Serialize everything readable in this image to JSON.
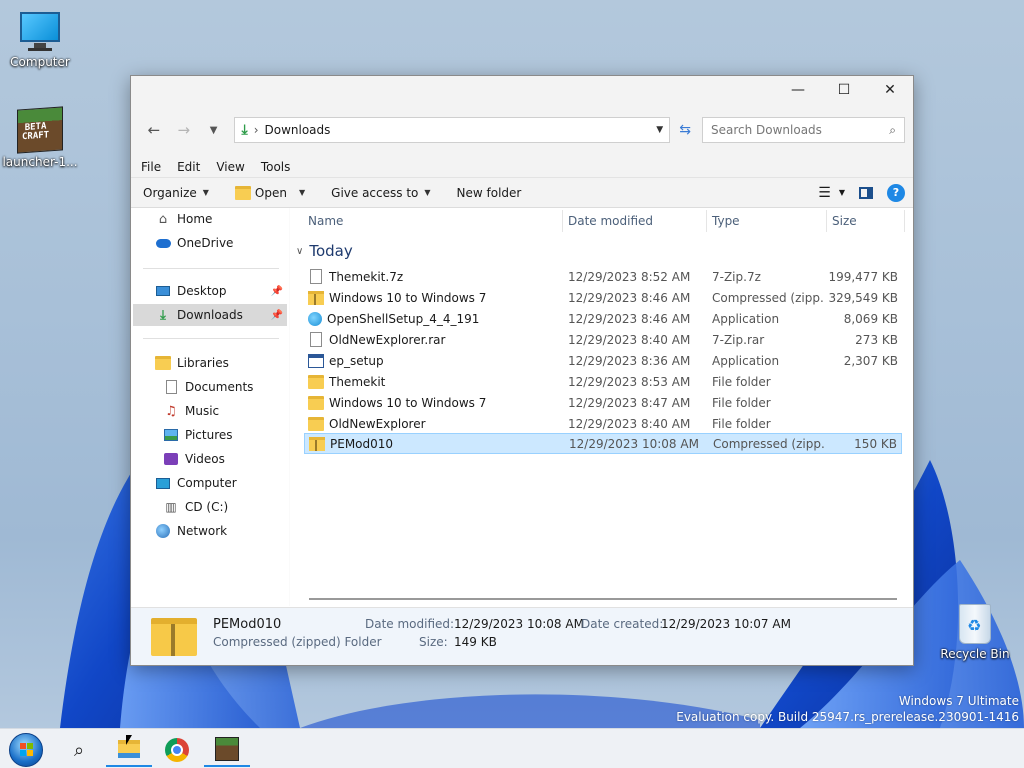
{
  "desktop": {
    "icons": [
      {
        "label": "Computer"
      },
      {
        "label": "launcher-1..."
      },
      {
        "label": "Recycle Bin"
      }
    ],
    "watermark": {
      "line1": "Windows 7 Ultimate",
      "line2": "Evaluation copy. Build 25947.rs_prerelease.230901-1416"
    }
  },
  "window": {
    "controls": {
      "minimize": "—",
      "maximize": "☐",
      "close": "✕"
    },
    "address": {
      "crumb_separator": "›",
      "location": "Downloads"
    },
    "search": {
      "placeholder": "Search Downloads"
    },
    "menu": [
      "File",
      "Edit",
      "View",
      "Tools"
    ],
    "commands": {
      "organize": "Organize",
      "open": "Open",
      "give_access": "Give access to",
      "new_folder": "New folder"
    },
    "nav": [
      {
        "label": "Home",
        "icon": "home-icon"
      },
      {
        "label": "OneDrive",
        "icon": "cloud-icon"
      },
      {
        "label": "Desktop",
        "icon": "desktop-icon",
        "pinned": true
      },
      {
        "label": "Downloads",
        "icon": "download-icon",
        "pinned": true,
        "selected": true
      },
      {
        "label": "Libraries",
        "icon": "libraries-icon"
      },
      {
        "label": "Documents",
        "icon": "documents-icon"
      },
      {
        "label": "Music",
        "icon": "music-icon"
      },
      {
        "label": "Pictures",
        "icon": "pictures-icon"
      },
      {
        "label": "Videos",
        "icon": "videos-icon"
      },
      {
        "label": "Computer",
        "icon": "computer-icon"
      },
      {
        "label": "CD (C:)",
        "icon": "drive-icon"
      },
      {
        "label": "Network",
        "icon": "network-icon"
      }
    ],
    "columns": {
      "name": "Name",
      "date": "Date modified",
      "type": "Type",
      "size": "Size"
    },
    "group": "Today",
    "files": [
      {
        "name": "Themekit.7z",
        "date": "12/29/2023 8:52 AM",
        "type": "7-Zip.7z",
        "size": "199,477 KB",
        "icon": "document-icon"
      },
      {
        "name": "Windows 10 to Windows 7",
        "date": "12/29/2023 8:46 AM",
        "type": "Compressed (zipp...",
        "size": "329,549 KB",
        "icon": "zip-folder-icon"
      },
      {
        "name": "OpenShellSetup_4_4_191",
        "date": "12/29/2023 8:46 AM",
        "type": "Application",
        "size": "8,069 KB",
        "icon": "shell-icon"
      },
      {
        "name": "OldNewExplorer.rar",
        "date": "12/29/2023 8:40 AM",
        "type": "7-Zip.rar",
        "size": "273 KB",
        "icon": "document-icon"
      },
      {
        "name": "ep_setup",
        "date": "12/29/2023 8:36 AM",
        "type": "Application",
        "size": "2,307 KB",
        "icon": "app-icon"
      },
      {
        "name": "Themekit",
        "date": "12/29/2023 8:53 AM",
        "type": "File folder",
        "size": "",
        "icon": "folder-icon"
      },
      {
        "name": "Windows 10 to Windows 7",
        "date": "12/29/2023 8:47 AM",
        "type": "File folder",
        "size": "",
        "icon": "folder-icon"
      },
      {
        "name": "OldNewExplorer",
        "date": "12/29/2023 8:40 AM",
        "type": "File folder",
        "size": "",
        "icon": "folder-icon"
      },
      {
        "name": "PEMod010",
        "date": "12/29/2023 10:08 AM",
        "type": "Compressed (zipp...",
        "size": "150 KB",
        "icon": "zip-folder-icon",
        "selected": true
      }
    ],
    "details": {
      "name": "PEMod010",
      "kind": "Compressed (zipped) Folder",
      "date_modified_label": "Date modified:",
      "date_modified": "12/29/2023 10:08 AM",
      "date_created_label": "Date created:",
      "date_created": "12/29/2023 10:07 AM",
      "size_label": "Size:",
      "size": "149 KB"
    }
  },
  "taskbar": {
    "items": [
      "start-orb-icon",
      "search-icon",
      "file-explorer-icon",
      "chrome-icon",
      "beta-craft-icon"
    ]
  },
  "colors": {
    "accent": "#1e88e5",
    "selection": "#cce8ff",
    "folder": "#f8cd52"
  }
}
